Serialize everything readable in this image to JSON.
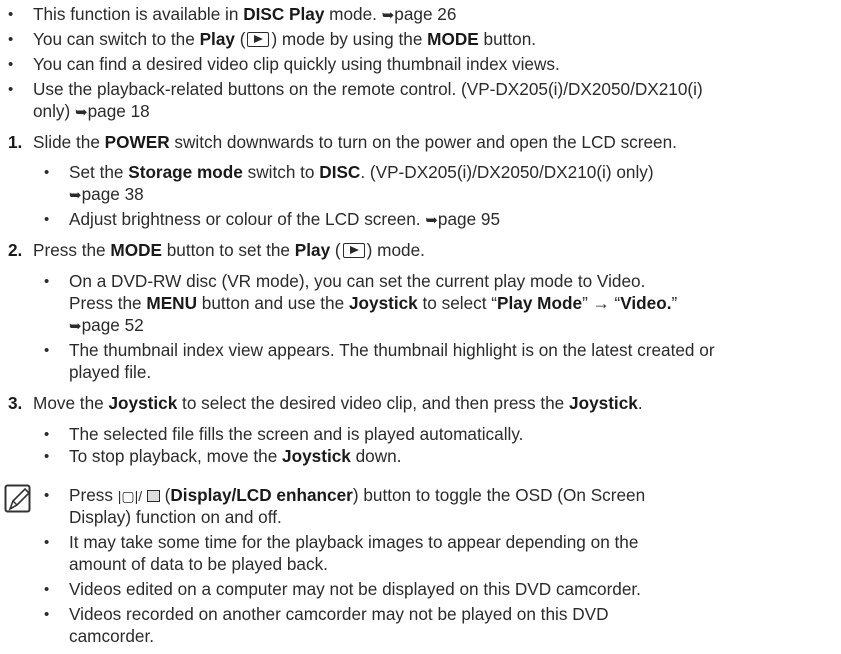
{
  "intro": [
    {
      "parts": [
        "This function is available in ",
        "DISC Play",
        " mode. ",
        "➥",
        "page 26"
      ]
    },
    {
      "parts": [
        "You can switch to the ",
        "Play",
        " (",
        ") mode by using the ",
        "MODE",
        " button."
      ]
    },
    {
      "text": "You can find a desired video clip quickly using thumbnail index views."
    },
    {
      "line1": "Use the playback-related buttons on the remote control. (VP-DX205(i)/DX2050/DX210(i)",
      "line2": "only) ",
      "arrow": "➥",
      "page": "page 18"
    }
  ],
  "steps": [
    {
      "number": "1.",
      "parts": [
        "Slide the ",
        "POWER",
        " switch downwards to turn on the power and open the LCD screen."
      ],
      "bullets": [
        {
          "parts": [
            "Set the ",
            "Storage mode",
            " switch to ",
            "DISC",
            ". (VP-DX205(i)/DX2050/DX210(i) only)"
          ],
          "line2": "page 38"
        },
        {
          "text": "Adjust brightness or colour of the LCD screen. ",
          "page": "page 95"
        }
      ]
    },
    {
      "number": "2.",
      "parts": [
        "Press the ",
        "MODE",
        " button to set the ",
        "Play",
        " (",
        ") mode."
      ],
      "bullets": [
        {
          "line1": "On a DVD-RW disc (VR mode), you can set the current play mode to Video.",
          "parts2": [
            "Press the ",
            "MENU",
            " button and use the ",
            "Joystick",
            " to select “",
            "Play Mode",
            "” → “",
            "Video.",
            "”"
          ],
          "line3": "page 52"
        },
        {
          "line1": "The thumbnail index view appears. The thumbnail highlight is on the latest created or",
          "line2": "played file."
        }
      ]
    },
    {
      "number": "3.",
      "parts": [
        "Move the ",
        "Joystick",
        " to select the desired video clip, and then press the ",
        "Joystick",
        "."
      ],
      "bullets": [
        {
          "text": "The selected file fills the screen and is played automatically."
        },
        {
          "parts": [
            "To stop playback, move the ",
            "Joystick",
            " down."
          ]
        }
      ]
    }
  ],
  "notes": [
    {
      "parts": [
        "Press ",
        " (",
        "Display/LCD enhancer",
        ") button to toggle the OSD (On Screen"
      ],
      "line2": "Display) function on and off."
    },
    {
      "line1": "It may take some time for the playback images to appear depending on the",
      "line2": "amount of data to be played back."
    },
    {
      "text": "Videos edited on a computer may not be displayed on this DVD camcorder."
    },
    {
      "line1": "Videos recorded on another camcorder may not be played on this DVD",
      "line2": "camcorder."
    }
  ],
  "bullet_char": "•",
  "note_icon": "memo-pencil-icon",
  "play_icon": "play-mode-icon",
  "display_icon": "display-lcd-icon"
}
